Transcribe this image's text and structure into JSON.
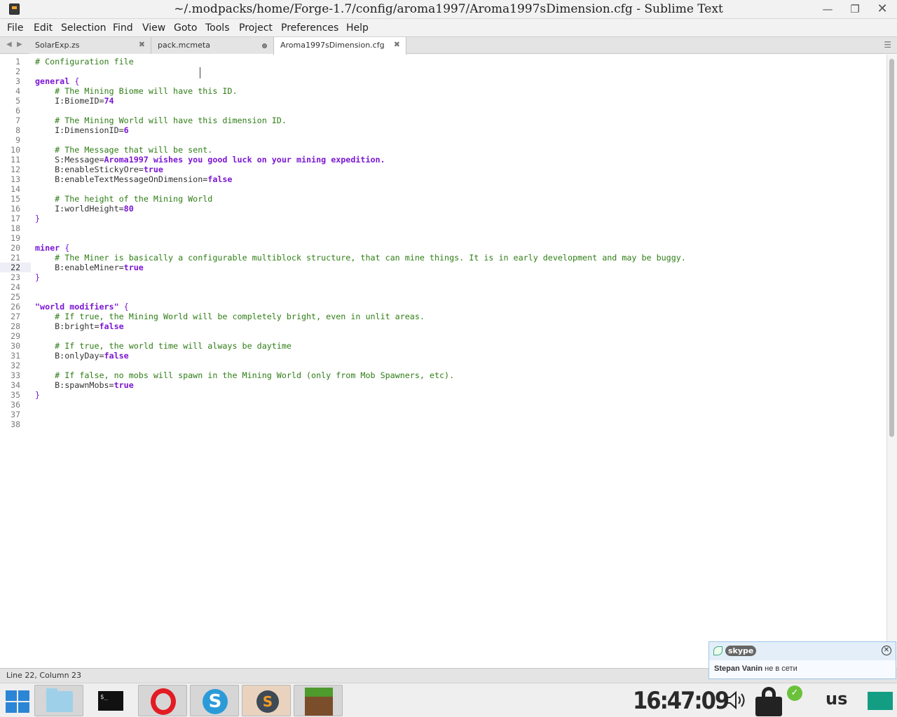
{
  "window": {
    "title": "~/.modpacks/home/Forge-1.7/config/aroma1997/Aroma1997sDimension.cfg - Sublime Text",
    "minimize_glyph": "—",
    "maximize_glyph": "❐",
    "close_glyph": "✕"
  },
  "menu": {
    "items": [
      "File",
      "Edit",
      "Selection",
      "Find",
      "View",
      "Goto",
      "Tools",
      "Project",
      "Preferences",
      "Help"
    ]
  },
  "tabs": {
    "nav_left": "◀",
    "nav_right": "▶",
    "items": [
      {
        "label": "SolarExp.zs",
        "state": "close",
        "close_glyph": "✖"
      },
      {
        "label": "pack.mcmeta",
        "state": "dirty"
      },
      {
        "label": "Aroma1997sDimension.cfg",
        "state": "active",
        "close_glyph": "✖"
      }
    ],
    "menu_glyph": "☰"
  },
  "editor": {
    "current_line": 22,
    "line_numbers": [
      "1",
      "2",
      "3",
      "4",
      "5",
      "6",
      "7",
      "8",
      "9",
      "10",
      "11",
      "12",
      "13",
      "14",
      "15",
      "16",
      "17",
      "18",
      "19",
      "20",
      "21",
      "22",
      "23",
      "24",
      "25",
      "26",
      "27",
      "28",
      "29",
      "30",
      "31",
      "32",
      "33",
      "34",
      "35",
      "36",
      "37",
      "38"
    ],
    "lines": [
      [
        {
          "t": "# Configuration file",
          "c": "comment"
        }
      ],
      [],
      [
        {
          "t": "general",
          "c": "kw"
        },
        {
          "t": " {",
          "c": "brace"
        }
      ],
      [
        {
          "t": "    ",
          "c": "plain"
        },
        {
          "t": "# The Mining Biome will have this ID.",
          "c": "comment"
        }
      ],
      [
        {
          "t": "    I:BiomeID=",
          "c": "plain"
        },
        {
          "t": "74",
          "c": "val"
        }
      ],
      [],
      [
        {
          "t": "    ",
          "c": "plain"
        },
        {
          "t": "# The Mining World will have this dimension ID.",
          "c": "comment"
        }
      ],
      [
        {
          "t": "    I:DimensionID=",
          "c": "plain"
        },
        {
          "t": "6",
          "c": "val"
        }
      ],
      [],
      [
        {
          "t": "    ",
          "c": "plain"
        },
        {
          "t": "# The Message that will be sent.",
          "c": "comment"
        }
      ],
      [
        {
          "t": "    S:Message=",
          "c": "plain"
        },
        {
          "t": "Aroma1997 wishes you good luck on your mining expedition.",
          "c": "val"
        }
      ],
      [
        {
          "t": "    B:enableStickyOre=",
          "c": "plain"
        },
        {
          "t": "true",
          "c": "val"
        }
      ],
      [
        {
          "t": "    B:enableTextMessageOnDimension=",
          "c": "plain"
        },
        {
          "t": "false",
          "c": "val"
        }
      ],
      [],
      [
        {
          "t": "    ",
          "c": "plain"
        },
        {
          "t": "# The height of the Mining World",
          "c": "comment"
        }
      ],
      [
        {
          "t": "    I:worldHeight=",
          "c": "plain"
        },
        {
          "t": "80",
          "c": "val"
        }
      ],
      [
        {
          "t": "}",
          "c": "brace"
        }
      ],
      [],
      [],
      [
        {
          "t": "miner",
          "c": "kw"
        },
        {
          "t": " {",
          "c": "brace"
        }
      ],
      [
        {
          "t": "    ",
          "c": "plain"
        },
        {
          "t": "# The Miner is basically a configurable multiblock structure, that can mine things. It is in early development and may be buggy.",
          "c": "comment"
        }
      ],
      [
        {
          "t": "    B:enableMiner=",
          "c": "plain"
        },
        {
          "t": "true",
          "c": "val"
        }
      ],
      [
        {
          "t": "}",
          "c": "brace"
        }
      ],
      [],
      [],
      [
        {
          "t": "\"world modifiers\"",
          "c": "kw"
        },
        {
          "t": " {",
          "c": "brace"
        }
      ],
      [
        {
          "t": "    ",
          "c": "plain"
        },
        {
          "t": "# If true, the Mining World will be completely bright, even in unlit areas.",
          "c": "comment"
        }
      ],
      [
        {
          "t": "    B:bright=",
          "c": "plain"
        },
        {
          "t": "false",
          "c": "val"
        }
      ],
      [],
      [
        {
          "t": "    ",
          "c": "plain"
        },
        {
          "t": "# If true, the world time will always be daytime",
          "c": "comment"
        }
      ],
      [
        {
          "t": "    B:onlyDay=",
          "c": "plain"
        },
        {
          "t": "false",
          "c": "val"
        }
      ],
      [],
      [
        {
          "t": "    ",
          "c": "plain"
        },
        {
          "t": "# If false, no mobs will spawn in the Mining World (only from Mob Spawners, etc).",
          "c": "comment"
        }
      ],
      [
        {
          "t": "    B:spawnMobs=",
          "c": "plain"
        },
        {
          "t": "true",
          "c": "val"
        }
      ],
      [
        {
          "t": "}",
          "c": "brace"
        }
      ],
      [],
      [],
      []
    ]
  },
  "status": {
    "position": "Line 22, Column 23"
  },
  "skype": {
    "logo": "skype",
    "close_glyph": "✕",
    "contact": "Stepan Vanin",
    "message": "не в сети"
  },
  "taskbar": {
    "terminal_prompt": "$_",
    "skype_letter": "S",
    "sublime_letter": "S",
    "clock": "16:47:09",
    "badge_glyph": "✓",
    "keyboard_layout": "us"
  }
}
